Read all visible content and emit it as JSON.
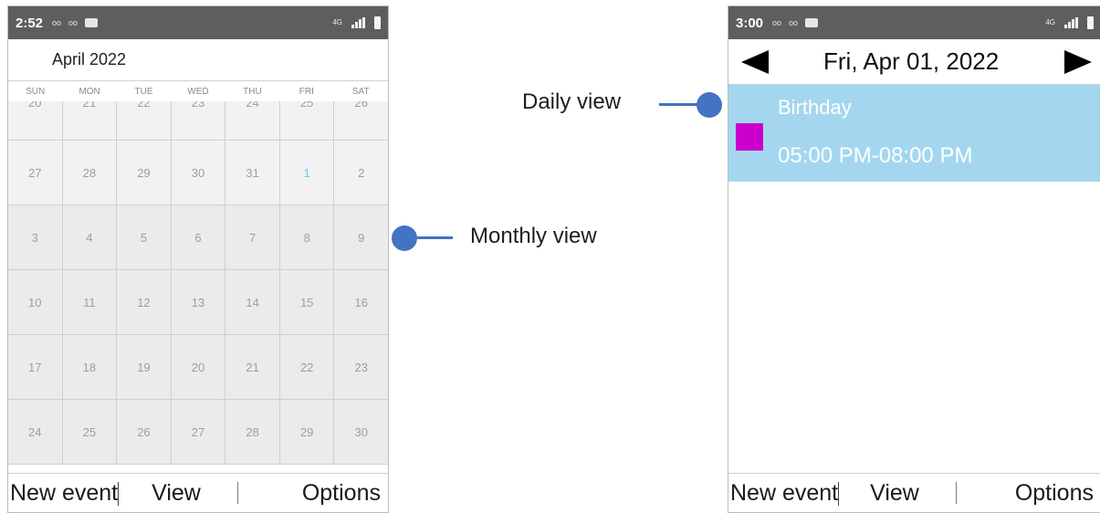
{
  "left_phone": {
    "status": {
      "time": "2:52",
      "icon_a": "oo",
      "icon_b": "oo",
      "network": "4G"
    },
    "month_title": "April 2022",
    "weekdays": [
      "SUN",
      "MON",
      "TUE",
      "WED",
      "THU",
      "FRI",
      "SAT"
    ],
    "partial_row": [
      "20",
      "21",
      "22",
      "23",
      "24",
      "25",
      "26"
    ],
    "weeks": [
      [
        "27",
        "28",
        "29",
        "30",
        "31",
        "1",
        "2"
      ],
      [
        "3",
        "4",
        "5",
        "6",
        "7",
        "8",
        "9"
      ],
      [
        "10",
        "11",
        "12",
        "13",
        "14",
        "15",
        "16"
      ],
      [
        "17",
        "18",
        "19",
        "20",
        "21",
        "22",
        "23"
      ],
      [
        "24",
        "25",
        "26",
        "27",
        "28",
        "29",
        "30"
      ]
    ],
    "selected_day": "1",
    "softkeys": {
      "left": "New event",
      "center": "View",
      "right": "Options"
    }
  },
  "right_phone": {
    "status": {
      "time": "3:00",
      "icon_a": "oo",
      "icon_b": "oo",
      "network": "4G"
    },
    "date_title": "Fri, Apr 01, 2022",
    "event": {
      "title": "Birthday",
      "time": "05:00 PM-08:00 PM",
      "color": "#cc00cc"
    },
    "softkeys": {
      "left": "New event",
      "center": "View",
      "right": "Options"
    }
  },
  "callouts": {
    "monthly": "Monthly view",
    "daily": "Daily view"
  },
  "colors": {
    "accent_callout": "#4472c4",
    "selected_day": "#32b3e8",
    "event_bg": "#a4d7ef"
  }
}
